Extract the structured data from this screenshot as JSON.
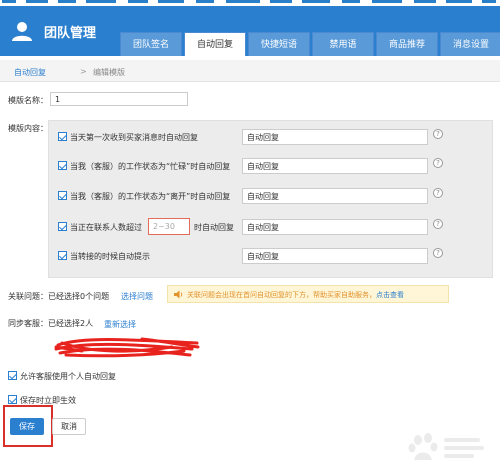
{
  "app": {
    "brand": "团队管理"
  },
  "tabs": [
    {
      "label": "团队签名",
      "active": false
    },
    {
      "label": "自动回复",
      "active": true
    },
    {
      "label": "快捷短语",
      "active": false
    },
    {
      "label": "禁用语",
      "active": false
    },
    {
      "label": "商品推荐",
      "active": false
    },
    {
      "label": "消息设置",
      "active": false
    }
  ],
  "breadcrumb": {
    "parent": "自动回复",
    "separator": ">",
    "current": "编辑模版"
  },
  "form": {
    "template_name_label": "模版名称：",
    "template_name_value": "1",
    "content_label": "模版内容：",
    "rules": [
      {
        "label": "当天第一次收到买家消息时自动回复",
        "value": "自动回复",
        "checked": true
      },
      {
        "label": "当我（客服）的工作状态为“忙碌”时自动回复",
        "value": "自动回复",
        "checked": true
      },
      {
        "label": "当我（客服）的工作状态为“离开”时自动回复",
        "value": "自动回复",
        "checked": true
      },
      {
        "label_prefix": "当正在联系人数超过",
        "number_placeholder": "2~30",
        "label_suffix": "时自动回复",
        "value": "自动回复",
        "checked": true
      },
      {
        "label": "当转接的时候自动提示",
        "value": "自动回复",
        "checked": true
      }
    ],
    "help_glyph": "?",
    "related_label": "关联问题：已经选择0个问题",
    "related_link": "选择问题",
    "notice_text": "关联问题会出现在首问自动回复的下方，帮助买家自助服务，",
    "notice_link": "点击查看",
    "sync_label": "同步客服：已经选择2人",
    "sync_link": "重新选择",
    "allow_personal_label": "允许客服使用个人自动回复",
    "allow_personal_checked": true,
    "save_effective_label": "保存时立即生效",
    "save_effective_checked": true
  },
  "buttons": {
    "save": "保存",
    "cancel": "取消"
  },
  "colors": {
    "header": "#2b7fcf",
    "accent": "#2b7fcf",
    "highlight": "#d9302a",
    "scribble": "#e8231e"
  }
}
